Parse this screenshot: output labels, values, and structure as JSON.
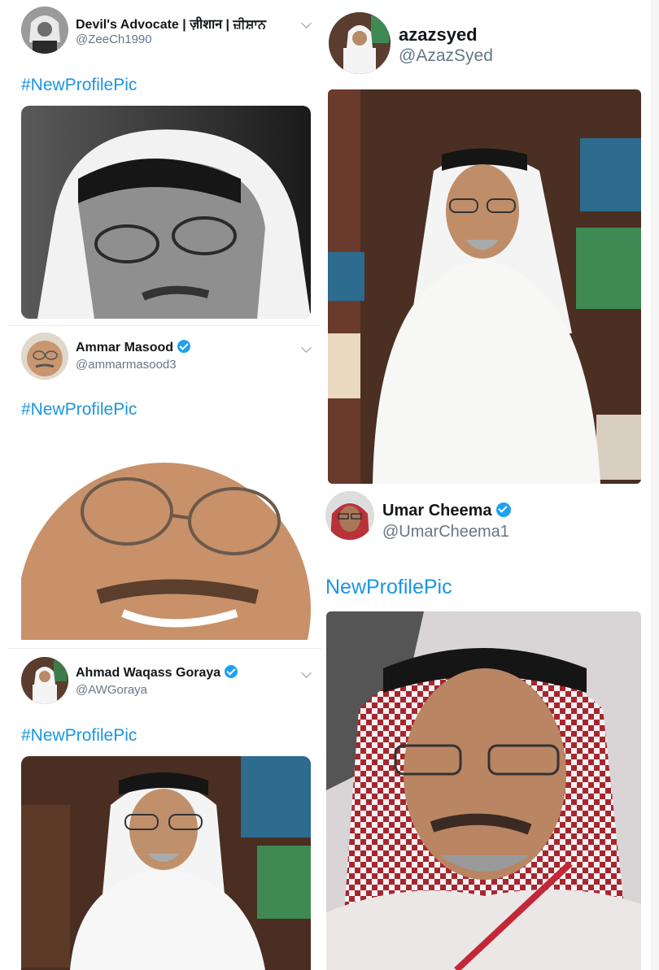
{
  "tweets": [
    {
      "name": "Devil's Advocate | ज़ीशान | ਜ਼ੀਸ਼ਾਨ",
      "handle": "@ZeeCh1990",
      "text": "#NewProfilePic",
      "verified": false
    },
    {
      "name": "azazsyed",
      "handle": "@AzazSyed",
      "text": "",
      "verified": false
    },
    {
      "name": "Ammar Masood",
      "handle": "@ammarmasood3",
      "text": "#NewProfilePic",
      "verified": true
    },
    {
      "name": "Umar Cheema",
      "handle": "@UmarCheema1",
      "text": "NewProfilePic",
      "verified": true
    },
    {
      "name": "Ahmad Waqass Goraya",
      "handle": "@AWGoraya",
      "text": "#NewProfilePic",
      "verified": true
    }
  ],
  "icons": [
    "chevron-down-icon",
    "verified-badge-icon",
    "profile-photo"
  ],
  "colors": {
    "link": "#1b95e0",
    "handle": "#657786",
    "verified": "#1da1f2",
    "divider": "#e6ecf0"
  }
}
